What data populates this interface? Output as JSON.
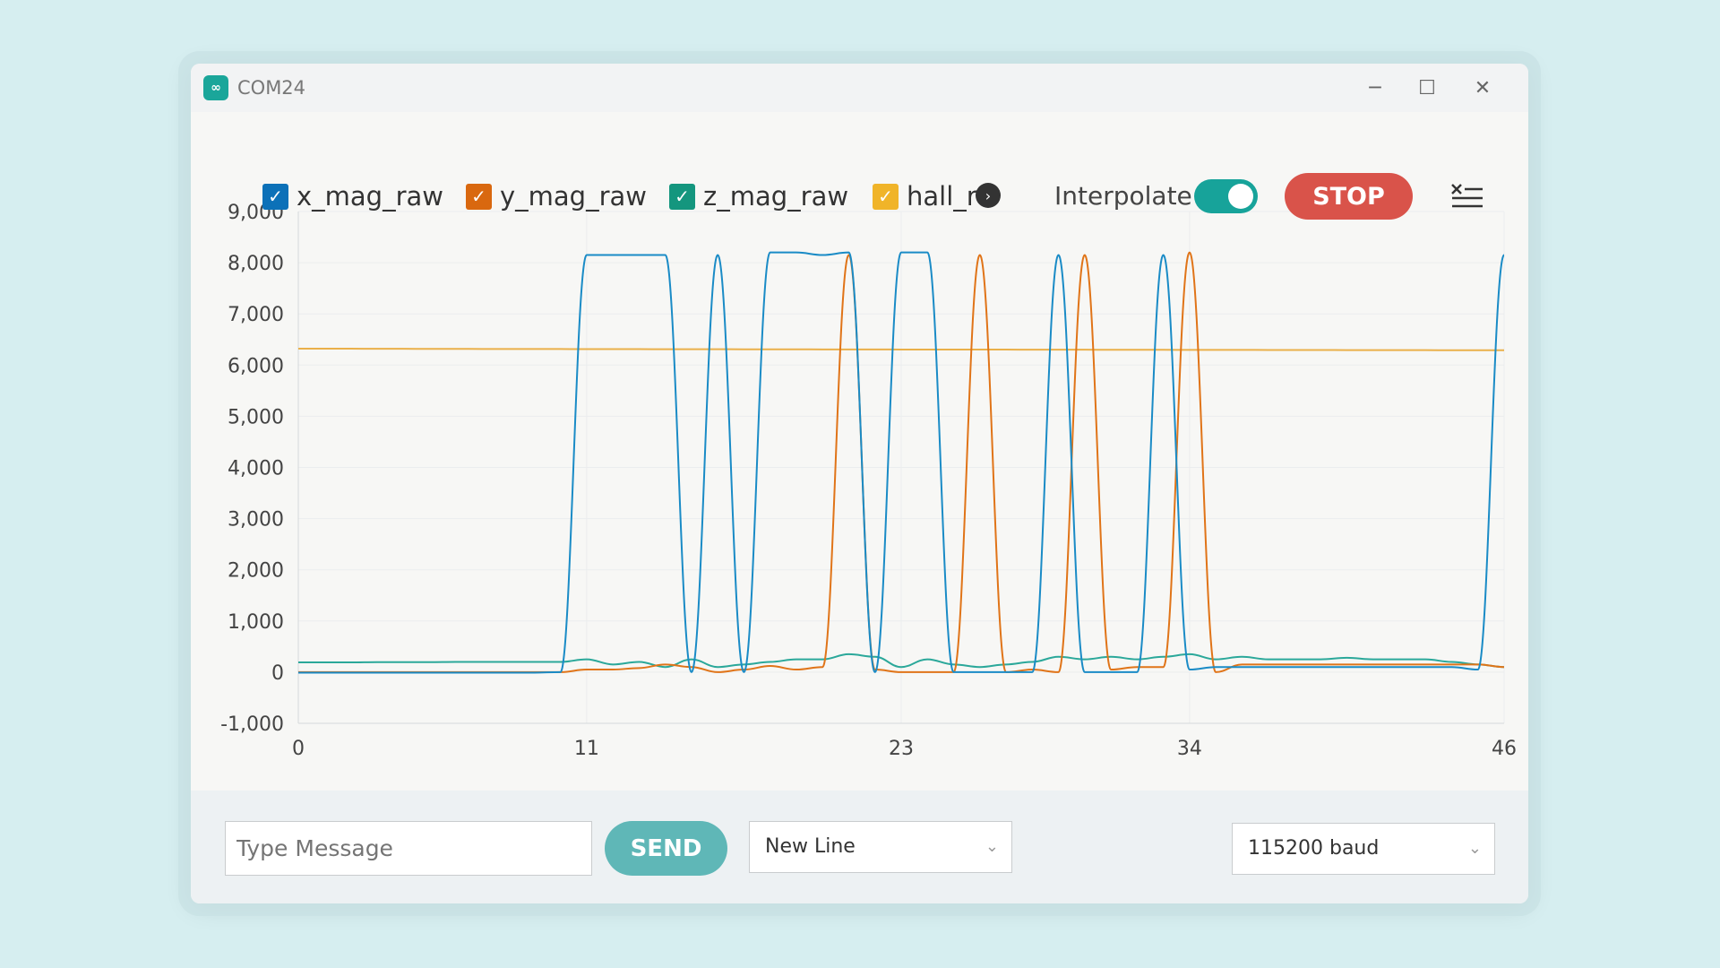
{
  "window": {
    "title": "COM24",
    "icon": "arduino-infinity-icon",
    "minimize": "─",
    "maximize": "☐",
    "close": "✕"
  },
  "toolbar": {
    "legend": [
      {
        "label": "x_mag_raw",
        "color": "#0c71b8",
        "checked": true
      },
      {
        "label": "y_mag_raw",
        "color": "#d9680f",
        "checked": true
      },
      {
        "label": "z_mag_raw",
        "color": "#14967e",
        "checked": true
      },
      {
        "label": "hall_raw",
        "color": "#f0b429",
        "checked": true
      }
    ],
    "check": "✓",
    "scroll_icon": "›",
    "interpolate_label": "Interpolate",
    "interpolate_on": true,
    "stop_label": "STOP"
  },
  "chart_data": {
    "type": "line",
    "xlim": [
      0,
      46
    ],
    "ylim": [
      -1000,
      9000
    ],
    "x_ticks": [
      "0",
      "11",
      "23",
      "34",
      "46"
    ],
    "y_ticks": [
      "9,000",
      "8,000",
      "7,000",
      "6,000",
      "5,000",
      "4,000",
      "3,000",
      "2,000",
      "1,000",
      "0",
      "-1,000"
    ],
    "grid": true,
    "series": [
      {
        "name": "hall_raw",
        "color": "#eab04a",
        "values": [
          6320,
          6320,
          6320,
          6318,
          6318,
          6316,
          6316,
          6315,
          6314,
          6314,
          6313,
          6312,
          6312,
          6311,
          6310,
          6310,
          6309,
          6308,
          6308,
          6307,
          6306,
          6306,
          6305,
          6304,
          6304,
          6303,
          6302,
          6302,
          6301,
          6300,
          6300,
          6299,
          6298,
          6298,
          6297,
          6296,
          6296,
          6295,
          6294,
          6294,
          6293,
          6292,
          6292,
          6291,
          6290,
          6290,
          6290
        ]
      },
      {
        "name": "z_mag_raw",
        "color": "#2ba89a",
        "values": [
          190,
          190,
          190,
          195,
          195,
          195,
          200,
          200,
          200,
          200,
          200,
          250,
          150,
          200,
          100,
          250,
          100,
          150,
          200,
          250,
          250,
          350,
          300,
          100,
          250,
          150,
          100,
          150,
          200,
          300,
          250,
          300,
          250,
          300,
          350,
          250,
          300,
          250,
          250,
          250,
          280,
          250,
          250,
          250,
          200,
          150,
          100
        ]
      },
      {
        "name": "y_mag_raw",
        "color": "#e07418",
        "values": [
          0,
          0,
          0,
          0,
          0,
          0,
          0,
          0,
          0,
          0,
          0,
          50,
          50,
          80,
          150,
          100,
          0,
          50,
          120,
          50,
          100,
          8150,
          50,
          0,
          0,
          0,
          8150,
          0,
          50,
          0,
          8150,
          50,
          100,
          100,
          8200,
          0,
          150,
          150,
          150,
          150,
          150,
          150,
          150,
          150,
          150,
          150,
          100
        ]
      },
      {
        "name": "x_mag_raw",
        "color": "#1a8bc6",
        "values": [
          -10,
          -10,
          -10,
          -10,
          -10,
          -10,
          -10,
          -10,
          -10,
          -10,
          0,
          8150,
          8150,
          8150,
          8150,
          0,
          8150,
          0,
          8200,
          8200,
          8150,
          8200,
          0,
          8200,
          8200,
          0,
          0,
          0,
          0,
          8150,
          0,
          0,
          0,
          8150,
          50,
          100,
          100,
          100,
          100,
          100,
          100,
          100,
          100,
          100,
          100,
          50,
          8150
        ]
      }
    ]
  },
  "footer": {
    "message_placeholder": "Type Message",
    "send_label": "SEND",
    "line_ending": "New Line",
    "baud": "115200 baud",
    "chevron": "⌄"
  }
}
